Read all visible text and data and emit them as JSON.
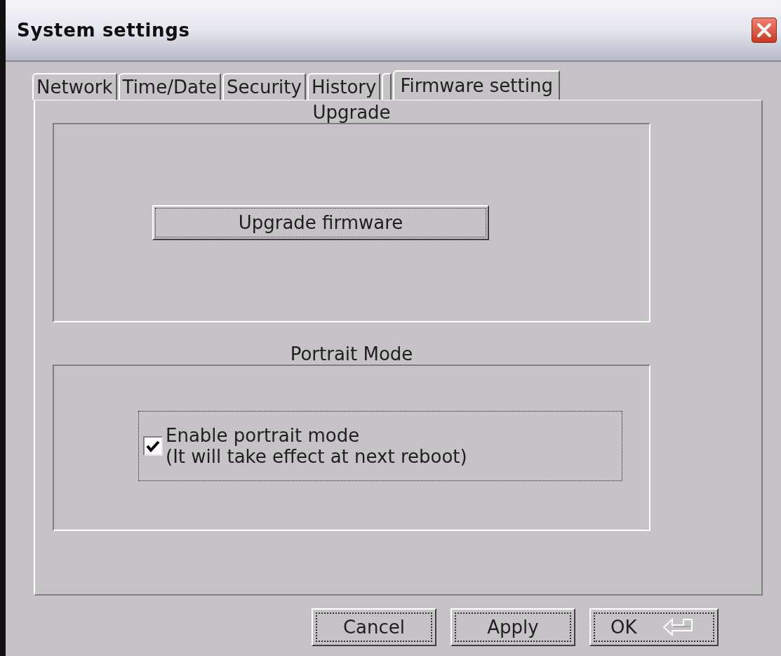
{
  "window": {
    "title": "System settings"
  },
  "tabs": [
    {
      "label": "Network",
      "selected": false
    },
    {
      "label": "Time/Date",
      "selected": false
    },
    {
      "label": "Security",
      "selected": false
    },
    {
      "label": "History",
      "selected": false
    },
    {
      "selected": false
    },
    {
      "label": "Firmware setting",
      "selected": true
    }
  ],
  "upgrade_group": {
    "title": "Upgrade",
    "button": "Upgrade firmware"
  },
  "portrait_group": {
    "title": "Portrait Mode",
    "checkbox": {
      "label": "Enable portrait mode",
      "note": "(It will take effect at next reboot)",
      "checked": true
    }
  },
  "buttons": [
    {
      "label": "Cancel",
      "kind": "plain"
    },
    {
      "label": "Apply",
      "kind": "plain"
    },
    {
      "label": "OK",
      "kind": "enter"
    }
  ]
}
